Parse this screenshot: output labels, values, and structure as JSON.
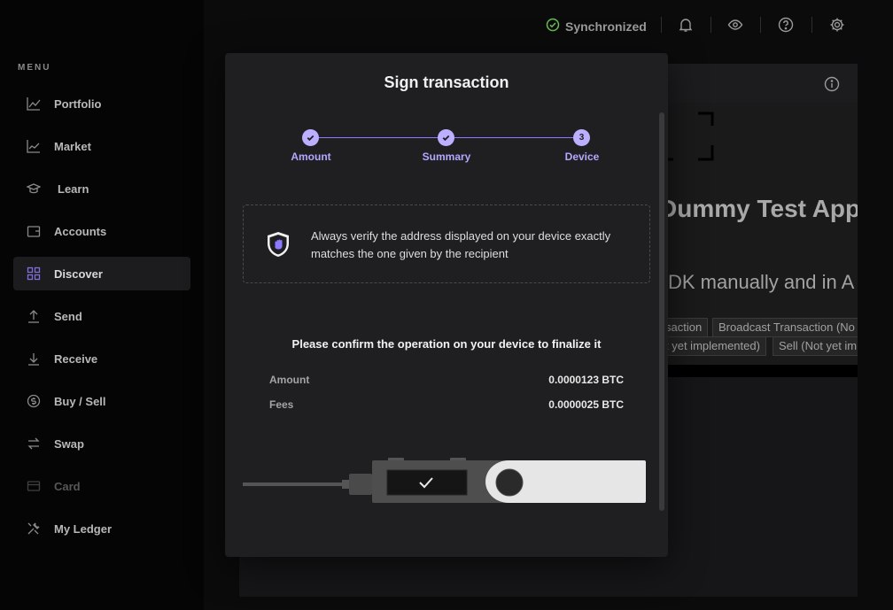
{
  "sidebar": {
    "menu_title": "MENU",
    "items": [
      {
        "label": "Portfolio",
        "icon": "chart-line-icon"
      },
      {
        "label": "Market",
        "icon": "market-chart-icon"
      },
      {
        "label": "Learn",
        "icon": "graduation-cap-icon"
      },
      {
        "label": "Accounts",
        "icon": "wallet-icon"
      },
      {
        "label": "Discover",
        "icon": "grid-icon",
        "active": true
      },
      {
        "label": "Send",
        "icon": "arrow-up-icon"
      },
      {
        "label": "Receive",
        "icon": "arrow-down-icon"
      },
      {
        "label": "Buy / Sell",
        "icon": "dollar-circle-icon"
      },
      {
        "label": "Swap",
        "icon": "swap-arrows-icon"
      },
      {
        "label": "Card",
        "icon": "card-icon",
        "disabled": true
      },
      {
        "label": "My Ledger",
        "icon": "tools-icon"
      }
    ]
  },
  "topbar": {
    "sync_label": "Synchronized",
    "sync_color": "#66be54",
    "icons": [
      "bell-icon",
      "eye-icon",
      "help-icon",
      "settings-gear-icon"
    ]
  },
  "background_app": {
    "title": "Dummy Test App",
    "subtitle": "DK manually and in A",
    "buttons_row1": [
      "saction",
      "Broadcast Transaction (No"
    ],
    "buttons_row2": [
      "t yet implemented)",
      "Sell (Not yet im"
    ]
  },
  "modal": {
    "title": "Sign transaction",
    "steps": [
      {
        "label": "Amount",
        "state": "done"
      },
      {
        "label": "Summary",
        "state": "done"
      },
      {
        "label": "Device",
        "state": "current",
        "number": "3"
      }
    ],
    "warning": "Always verify the address displayed on your device exactly matches the one given by the recipient",
    "confirm_text": "Please confirm the operation on your device to finalize it",
    "rows": [
      {
        "label": "Amount",
        "value": "0.0000123 BTC"
      },
      {
        "label": "Fees",
        "value": "0.0000025 BTC"
      }
    ],
    "accent_color": "#bbb0ff"
  }
}
